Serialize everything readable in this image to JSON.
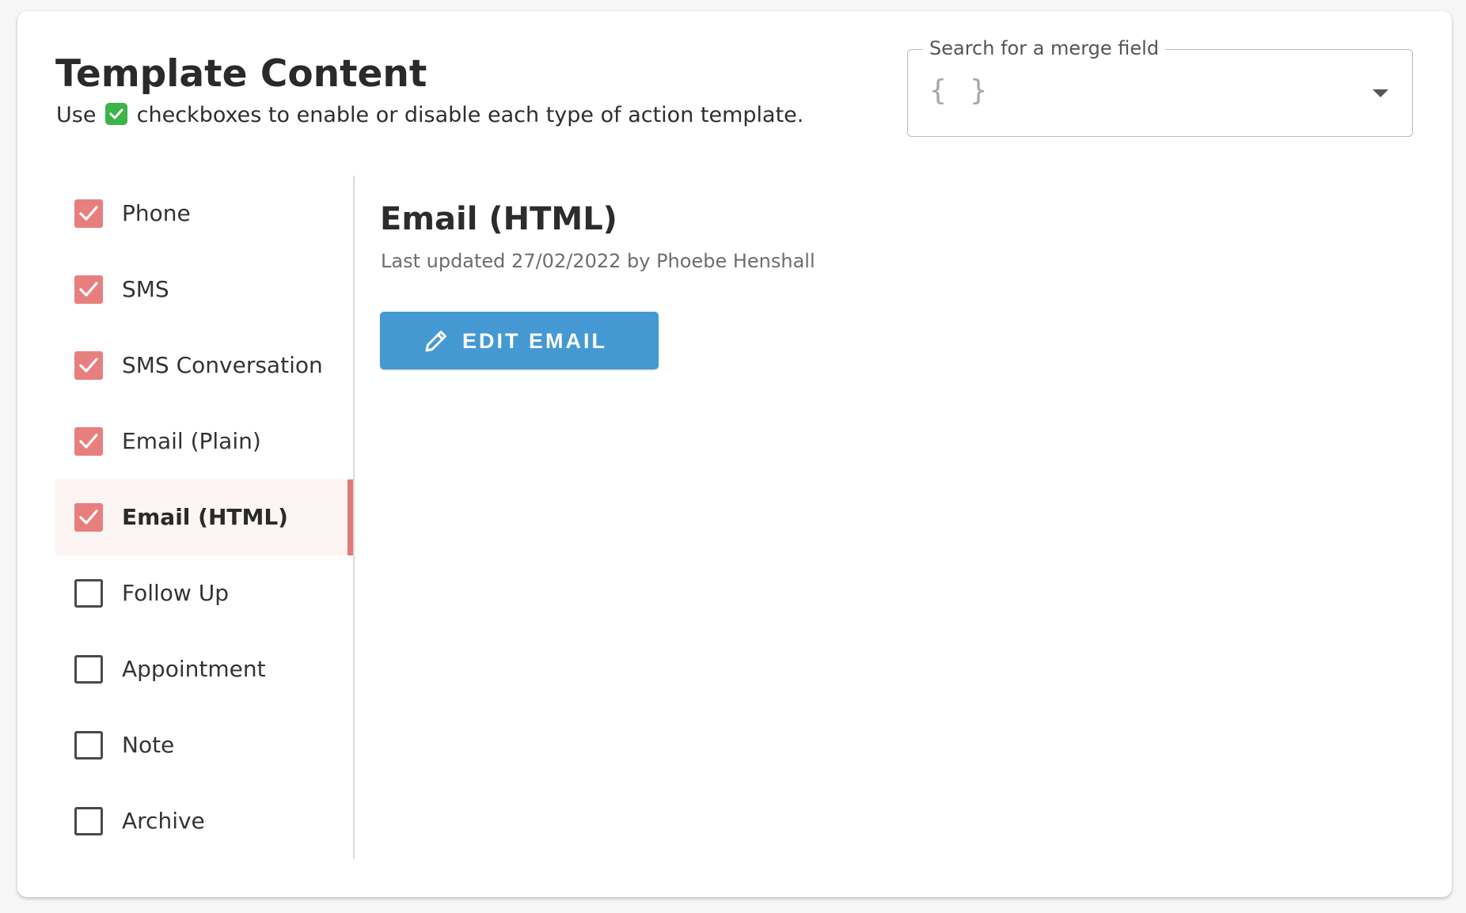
{
  "header": {
    "title": "Template Content",
    "subtitle_before": "Use",
    "subtitle_after": "checkboxes to enable or disable each type of action template."
  },
  "merge_field": {
    "label": "Search for a merge field",
    "placeholder_icon": "{ }"
  },
  "sidebar": {
    "items": [
      {
        "label": "Phone",
        "checked": true
      },
      {
        "label": "SMS",
        "checked": true
      },
      {
        "label": "SMS Conversation",
        "checked": true
      },
      {
        "label": "Email (Plain)",
        "checked": true
      },
      {
        "label": "Email (HTML)",
        "checked": true,
        "selected": true
      },
      {
        "label": "Follow Up",
        "checked": false
      },
      {
        "label": "Appointment",
        "checked": false
      },
      {
        "label": "Note",
        "checked": false
      },
      {
        "label": "Archive",
        "checked": false
      }
    ]
  },
  "content": {
    "title": "Email (HTML)",
    "last_updated": "Last updated 27/02/2022 by Phoebe Henshall",
    "edit_button_label": "EDIT EMAIL"
  },
  "colors": {
    "checkbox_checked": "#e87f7f",
    "active_indicator": "#e07a7a",
    "primary_button": "#4599d3",
    "inline_check": "#3bb449"
  }
}
